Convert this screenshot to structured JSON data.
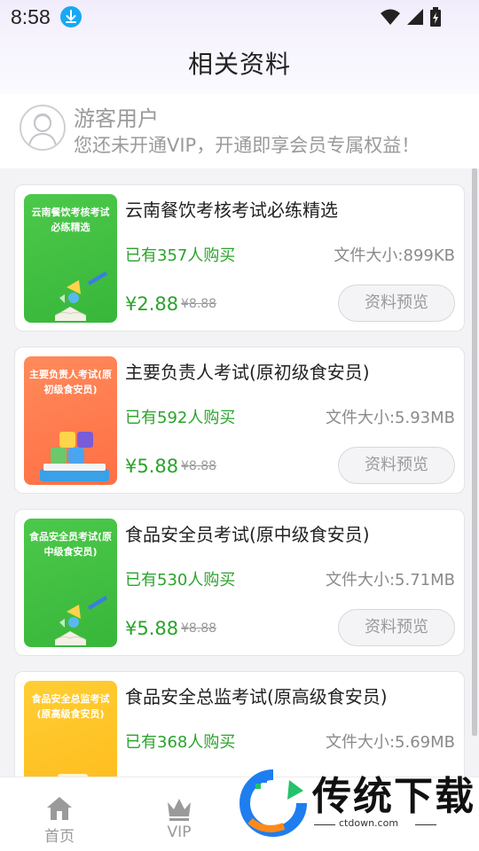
{
  "status_bar": {
    "time": "8:58"
  },
  "header": {
    "title": "相关资料"
  },
  "user": {
    "name": "游客用户",
    "tip": "您还未开通VIP，开通即享会员专属权益！"
  },
  "items": [
    {
      "cover_text": "云南餐饮考核考试必练精选",
      "cover_color": "#3fbf3f",
      "title": "云南餐饮考核考试必练精选",
      "buyers": "已有357人购买",
      "filesize": "文件大小:899KB",
      "price": "¥2.88",
      "original_price": "¥8.88",
      "preview_label": "资料预览"
    },
    {
      "cover_text": "主要负责人考试(原初级食安员)",
      "cover_color": "#ff7a4d",
      "title": "主要负责人考试(原初级食安员)",
      "buyers": "已有592人购买",
      "filesize": "文件大小:5.93MB",
      "price": "¥5.88",
      "original_price": "¥8.88",
      "preview_label": "资料预览"
    },
    {
      "cover_text": "食品安全员考试(原中级食安员)",
      "cover_color": "#3fbf3f",
      "title": "食品安全员考试(原中级食安员)",
      "buyers": "已有530人购买",
      "filesize": "文件大小:5.71MB",
      "price": "¥5.88",
      "original_price": "¥8.88",
      "preview_label": "资料预览"
    },
    {
      "cover_text": "食品安全总监考试(原高级食安员)",
      "cover_color": "#ffc226",
      "title": "食品安全总监考试(原高级食安员)",
      "buyers": "已有368人购买",
      "filesize": "文件大小:5.69MB",
      "price": "",
      "original_price": "",
      "preview_label": ""
    }
  ],
  "bottom_nav": [
    {
      "label": "首页",
      "icon": "home-icon"
    },
    {
      "label": "VIP",
      "icon": "crown-icon"
    }
  ],
  "watermark": {
    "text": "传统下载",
    "url": "ctdown.com"
  },
  "colors": {
    "accent_green": "#2aa32a",
    "muted": "#9a9a9a"
  }
}
